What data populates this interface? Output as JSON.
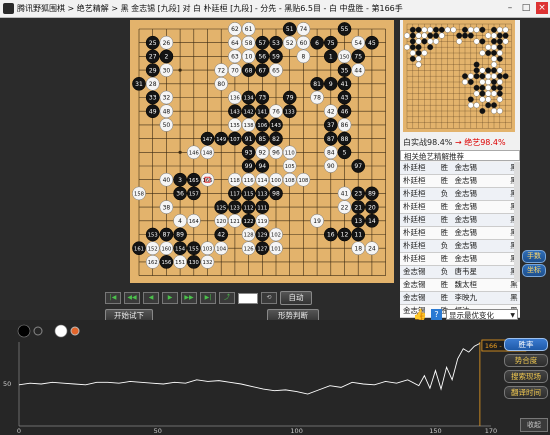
{
  "window": {
    "title": "腾讯野狐围棋 > 绝艺精解 > 黑 金志锡 [九段] 对 白 朴廷桓 [九段] - 分先 - 黑贴6.5目 - 白 中盘胜 - 第166手",
    "min": "–",
    "max": "□",
    "close": "×"
  },
  "board": {
    "size": 19,
    "stones": [
      [
        7,
        0,
        "w",
        "62"
      ],
      [
        8,
        0,
        "w",
        "61"
      ],
      [
        11,
        0,
        "b",
        "51"
      ],
      [
        12,
        0,
        "w",
        "74"
      ],
      [
        15,
        0,
        "b",
        "55"
      ],
      [
        1,
        1,
        "b",
        "25"
      ],
      [
        2,
        1,
        "w",
        "26"
      ],
      [
        7,
        1,
        "w",
        "64"
      ],
      [
        8,
        1,
        "w",
        "58"
      ],
      [
        9,
        1,
        "b",
        "57"
      ],
      [
        10,
        1,
        "b",
        "53"
      ],
      [
        11,
        1,
        "w",
        "52"
      ],
      [
        12,
        1,
        "w",
        "60"
      ],
      [
        13,
        1,
        "b",
        "6"
      ],
      [
        14,
        1,
        "b",
        "75"
      ],
      [
        16,
        1,
        "w",
        "54"
      ],
      [
        17,
        1,
        "b",
        "45"
      ],
      [
        1,
        2,
        "b",
        "27"
      ],
      [
        2,
        2,
        "b",
        "2"
      ],
      [
        7,
        2,
        "w",
        "63"
      ],
      [
        8,
        2,
        "w",
        "10"
      ],
      [
        9,
        2,
        "b",
        "56"
      ],
      [
        10,
        2,
        "b",
        "59"
      ],
      [
        12,
        2,
        "w",
        "8"
      ],
      [
        14,
        2,
        "b",
        "1"
      ],
      [
        15,
        2,
        "w",
        "150"
      ],
      [
        16,
        2,
        "b",
        "75"
      ],
      [
        1,
        3,
        "b",
        "29"
      ],
      [
        2,
        3,
        "w",
        "30"
      ],
      [
        6,
        3,
        "w",
        "72"
      ],
      [
        7,
        3,
        "w",
        "70"
      ],
      [
        8,
        3,
        "b",
        "68"
      ],
      [
        9,
        3,
        "b",
        "67"
      ],
      [
        10,
        3,
        "w",
        "65"
      ],
      [
        15,
        3,
        "b",
        "35"
      ],
      [
        16,
        3,
        "w",
        "44"
      ],
      [
        0,
        4,
        "b",
        "31"
      ],
      [
        1,
        4,
        "w",
        "28"
      ],
      [
        6,
        4,
        "w",
        "80"
      ],
      [
        13,
        4,
        "b",
        "81"
      ],
      [
        14,
        4,
        "b",
        "9"
      ],
      [
        15,
        4,
        "b",
        "41"
      ],
      [
        1,
        5,
        "b",
        "33"
      ],
      [
        2,
        5,
        "w",
        "32"
      ],
      [
        7,
        5,
        "w",
        "136"
      ],
      [
        8,
        5,
        "b",
        "134"
      ],
      [
        9,
        5,
        "b",
        "73"
      ],
      [
        11,
        5,
        "b",
        "79"
      ],
      [
        13,
        5,
        "w",
        "78"
      ],
      [
        15,
        5,
        "b",
        "43"
      ],
      [
        1,
        6,
        "b",
        "49"
      ],
      [
        2,
        6,
        "w",
        "48"
      ],
      [
        7,
        6,
        "b",
        "143"
      ],
      [
        8,
        6,
        "b",
        "142"
      ],
      [
        9,
        6,
        "b",
        "141"
      ],
      [
        10,
        6,
        "w",
        "76"
      ],
      [
        11,
        6,
        "b",
        "133"
      ],
      [
        14,
        6,
        "w",
        "42"
      ],
      [
        15,
        6,
        "b",
        "46"
      ],
      [
        2,
        7,
        "w",
        "50"
      ],
      [
        7,
        7,
        "w",
        "135"
      ],
      [
        8,
        7,
        "w",
        "138"
      ],
      [
        9,
        7,
        "b",
        "106"
      ],
      [
        10,
        7,
        "b",
        "143"
      ],
      [
        14,
        7,
        "b",
        "37"
      ],
      [
        15,
        7,
        "w",
        "86"
      ],
      [
        5,
        8,
        "b",
        "147"
      ],
      [
        6,
        8,
        "b",
        "149"
      ],
      [
        7,
        8,
        "b",
        "107"
      ],
      [
        8,
        8,
        "b",
        "91"
      ],
      [
        9,
        8,
        "b",
        "85"
      ],
      [
        10,
        8,
        "b",
        "82"
      ],
      [
        14,
        8,
        "b",
        "87"
      ],
      [
        15,
        8,
        "b",
        "88"
      ],
      [
        4,
        9,
        "w",
        "146"
      ],
      [
        5,
        9,
        "w",
        "148"
      ],
      [
        8,
        9,
        "b",
        "93"
      ],
      [
        9,
        9,
        "w",
        "92"
      ],
      [
        10,
        9,
        "w",
        "96"
      ],
      [
        11,
        9,
        "w",
        "110"
      ],
      [
        14,
        9,
        "w",
        "84"
      ],
      [
        15,
        9,
        "b",
        "5"
      ],
      [
        8,
        10,
        "b",
        "99"
      ],
      [
        9,
        10,
        "b",
        "94"
      ],
      [
        11,
        10,
        "w",
        "105"
      ],
      [
        14,
        10,
        "w",
        "90"
      ],
      [
        16,
        10,
        "b",
        "97"
      ],
      [
        2,
        11,
        "w",
        "40"
      ],
      [
        3,
        11,
        "b",
        "3"
      ],
      [
        4,
        11,
        "b",
        "165"
      ],
      [
        5,
        11,
        "w",
        "166"
      ],
      [
        7,
        11,
        "w",
        "118"
      ],
      [
        8,
        11,
        "w",
        "116"
      ],
      [
        9,
        11,
        "w",
        "114"
      ],
      [
        10,
        11,
        "w",
        "100"
      ],
      [
        11,
        11,
        "w",
        "108"
      ],
      [
        12,
        11,
        "w",
        "108"
      ],
      [
        0,
        12,
        "w",
        "158"
      ],
      [
        3,
        12,
        "b",
        "36"
      ],
      [
        4,
        12,
        "b",
        "157"
      ],
      [
        7,
        12,
        "b",
        "117"
      ],
      [
        8,
        12,
        "b",
        "115"
      ],
      [
        9,
        12,
        "b",
        "113"
      ],
      [
        10,
        12,
        "b",
        "98"
      ],
      [
        15,
        12,
        "w",
        "41"
      ],
      [
        16,
        12,
        "b",
        "23"
      ],
      [
        17,
        12,
        "b",
        "89"
      ],
      [
        2,
        13,
        "w",
        "38"
      ],
      [
        6,
        13,
        "b",
        "125"
      ],
      [
        7,
        13,
        "b",
        "123"
      ],
      [
        8,
        13,
        "b",
        "112"
      ],
      [
        9,
        13,
        "b",
        "111"
      ],
      [
        15,
        13,
        "w",
        "22"
      ],
      [
        16,
        13,
        "b",
        "21"
      ],
      [
        17,
        13,
        "b",
        "20"
      ],
      [
        3,
        14,
        "w",
        "4"
      ],
      [
        4,
        14,
        "w",
        "164"
      ],
      [
        6,
        14,
        "w",
        "120"
      ],
      [
        7,
        14,
        "w",
        "121"
      ],
      [
        8,
        14,
        "b",
        "122"
      ],
      [
        9,
        14,
        "w",
        "119"
      ],
      [
        13,
        14,
        "w",
        "19"
      ],
      [
        16,
        14,
        "b",
        "13"
      ],
      [
        17,
        14,
        "b",
        "14"
      ],
      [
        1,
        15,
        "b",
        "153"
      ],
      [
        2,
        15,
        "b",
        "87"
      ],
      [
        3,
        15,
        "b",
        "89"
      ],
      [
        6,
        15,
        "b",
        "42"
      ],
      [
        8,
        15,
        "w",
        "128"
      ],
      [
        9,
        15,
        "b",
        "129"
      ],
      [
        10,
        15,
        "w",
        "102"
      ],
      [
        14,
        15,
        "b",
        "16"
      ],
      [
        15,
        15,
        "b",
        "12"
      ],
      [
        16,
        15,
        "b",
        "11"
      ],
      [
        0,
        16,
        "b",
        "161"
      ],
      [
        1,
        16,
        "w",
        "152"
      ],
      [
        2,
        16,
        "w",
        "160"
      ],
      [
        3,
        16,
        "b",
        "154"
      ],
      [
        4,
        16,
        "b",
        "155"
      ],
      [
        5,
        16,
        "w",
        "103"
      ],
      [
        6,
        16,
        "w",
        "104"
      ],
      [
        8,
        16,
        "w",
        "126"
      ],
      [
        9,
        16,
        "b",
        "127"
      ],
      [
        10,
        16,
        "w",
        "101"
      ],
      [
        16,
        16,
        "w",
        "18"
      ],
      [
        17,
        16,
        "w",
        "24"
      ],
      [
        1,
        17,
        "w",
        "162"
      ],
      [
        2,
        17,
        "b",
        "156"
      ],
      [
        3,
        17,
        "w",
        "151"
      ],
      [
        4,
        17,
        "b",
        "130"
      ],
      [
        5,
        17,
        "w",
        "132"
      ]
    ],
    "last_move": [
      5,
      11
    ]
  },
  "minimap": {
    "stones": [
      [
        1,
        1,
        "b"
      ],
      [
        2,
        1,
        "b"
      ],
      [
        3,
        1,
        "w"
      ],
      [
        4,
        1,
        "w"
      ],
      [
        5,
        1,
        "b"
      ],
      [
        6,
        1,
        "b"
      ],
      [
        7,
        1,
        "w"
      ],
      [
        8,
        1,
        "w"
      ],
      [
        10,
        1,
        "b"
      ],
      [
        11,
        1,
        "w"
      ],
      [
        12,
        1,
        "w"
      ],
      [
        13,
        1,
        "b"
      ],
      [
        15,
        1,
        "b"
      ],
      [
        16,
        1,
        "w"
      ],
      [
        17,
        1,
        "w"
      ],
      [
        0,
        2,
        "w"
      ],
      [
        1,
        2,
        "b"
      ],
      [
        2,
        2,
        "w"
      ],
      [
        3,
        2,
        "w"
      ],
      [
        4,
        2,
        "b"
      ],
      [
        5,
        2,
        "b"
      ],
      [
        6,
        2,
        "w"
      ],
      [
        9,
        2,
        "b"
      ],
      [
        10,
        2,
        "b"
      ],
      [
        11,
        2,
        "b"
      ],
      [
        14,
        2,
        "w"
      ],
      [
        15,
        2,
        "w"
      ],
      [
        16,
        2,
        "b"
      ],
      [
        17,
        2,
        "b"
      ],
      [
        1,
        3,
        "b"
      ],
      [
        2,
        3,
        "w"
      ],
      [
        3,
        3,
        "b"
      ],
      [
        4,
        3,
        "w"
      ],
      [
        5,
        3,
        "w"
      ],
      [
        9,
        3,
        "w"
      ],
      [
        12,
        3,
        "w"
      ],
      [
        13,
        3,
        "b"
      ],
      [
        15,
        3,
        "b"
      ],
      [
        16,
        3,
        "b"
      ],
      [
        17,
        3,
        "w"
      ],
      [
        0,
        4,
        "w"
      ],
      [
        1,
        4,
        "b"
      ],
      [
        2,
        4,
        "b"
      ],
      [
        4,
        4,
        "b"
      ],
      [
        14,
        4,
        "w"
      ],
      [
        15,
        4,
        "w"
      ],
      [
        16,
        4,
        "b"
      ],
      [
        1,
        5,
        "w"
      ],
      [
        2,
        5,
        "b"
      ],
      [
        3,
        5,
        "w"
      ],
      [
        13,
        5,
        "w"
      ],
      [
        14,
        5,
        "b"
      ],
      [
        15,
        5,
        "b"
      ],
      [
        16,
        5,
        "w"
      ],
      [
        1,
        6,
        "b"
      ],
      [
        2,
        6,
        "w"
      ],
      [
        15,
        6,
        "w"
      ],
      [
        16,
        6,
        "b"
      ],
      [
        2,
        7,
        "w"
      ],
      [
        12,
        7,
        "b"
      ],
      [
        15,
        7,
        "w"
      ],
      [
        12,
        8,
        "b"
      ],
      [
        13,
        8,
        "w"
      ],
      [
        14,
        8,
        "b"
      ],
      [
        15,
        8,
        "b"
      ],
      [
        16,
        8,
        "w"
      ],
      [
        10,
        9,
        "b"
      ],
      [
        11,
        9,
        "w"
      ],
      [
        12,
        9,
        "b"
      ],
      [
        13,
        9,
        "b"
      ],
      [
        14,
        9,
        "w"
      ],
      [
        15,
        9,
        "w"
      ],
      [
        16,
        9,
        "b"
      ],
      [
        17,
        9,
        "b"
      ],
      [
        10,
        10,
        "w"
      ],
      [
        11,
        10,
        "b"
      ],
      [
        13,
        10,
        "w"
      ],
      [
        14,
        10,
        "w"
      ],
      [
        15,
        10,
        "b"
      ],
      [
        16,
        10,
        "w"
      ],
      [
        12,
        11,
        "b"
      ],
      [
        13,
        11,
        "b"
      ],
      [
        14,
        11,
        "w"
      ],
      [
        15,
        11,
        "b"
      ],
      [
        16,
        11,
        "b"
      ],
      [
        12,
        12,
        "w"
      ],
      [
        13,
        12,
        "b"
      ],
      [
        14,
        12,
        "w"
      ],
      [
        15,
        12,
        "w"
      ],
      [
        16,
        12,
        "b"
      ],
      [
        11,
        13,
        "b"
      ],
      [
        13,
        13,
        "w"
      ],
      [
        14,
        13,
        "w"
      ],
      [
        16,
        13,
        "w"
      ],
      [
        11,
        14,
        "w"
      ],
      [
        12,
        14,
        "w"
      ],
      [
        14,
        14,
        "b"
      ],
      [
        15,
        14,
        "b"
      ],
      [
        13,
        15,
        "b"
      ],
      [
        15,
        15,
        "w"
      ],
      [
        16,
        15,
        "w"
      ]
    ]
  },
  "score": {
    "label": "白实战98.4%",
    "ai": "→ 绝艺98.4%"
  },
  "related": {
    "header": "相关绝艺精解推荐",
    "rows": [
      [
        "朴廷桓",
        "胜",
        "金志锡",
        "黑"
      ],
      [
        "朴廷桓",
        "胜",
        "金志锡",
        "黑"
      ],
      [
        "朴廷桓",
        "负",
        "金志锡",
        "黑"
      ],
      [
        "朴廷桓",
        "胜",
        "金志锡",
        "黑"
      ],
      [
        "朴廷桓",
        "胜",
        "金志锡",
        "黑"
      ],
      [
        "朴廷桓",
        "胜",
        "金志锡",
        "黑"
      ],
      [
        "朴廷桓",
        "负",
        "金志锡",
        "黑"
      ],
      [
        "朴廷桓",
        "胜",
        "金志锡",
        "黑"
      ],
      [
        "金志锡",
        "负",
        "唐韦星",
        "黑"
      ],
      [
        "金志锡",
        "胜",
        "魏太桓",
        "黑"
      ],
      [
        "金志锡",
        "胜",
        "李映九",
        "黑"
      ],
      [
        "金志锡",
        "胜",
        "柯洁",
        "黑"
      ]
    ]
  },
  "side_buttons": {
    "a": "手数",
    "b": "坐标"
  },
  "nav": {
    "buttons": [
      "|◀",
      "◀◀",
      "◀",
      "▶",
      "▶▶",
      "▶|",
      "⤴"
    ],
    "page_btn": "⟲",
    "auto": "自动"
  },
  "actions": {
    "try": "开始试下",
    "judge": "形势判断",
    "select": "显示最优变化"
  },
  "graph": {
    "tooltip": "166 - 98.4%",
    "y_label": "50",
    "x_ticks": [
      0,
      50,
      100,
      150,
      170
    ]
  },
  "chart_data": {
    "type": "line",
    "title": "",
    "xlabel": "",
    "ylabel": "",
    "xlim": [
      0,
      170
    ],
    "ylim": [
      0,
      100
    ],
    "x": [
      0,
      4,
      8,
      12,
      16,
      20,
      24,
      28,
      32,
      36,
      40,
      44,
      48,
      52,
      56,
      60,
      64,
      68,
      72,
      76,
      80,
      84,
      88,
      92,
      96,
      100,
      104,
      108,
      112,
      116,
      120,
      124,
      128,
      132,
      136,
      140,
      144,
      146,
      148,
      150,
      152,
      154,
      156,
      158,
      160,
      162,
      164,
      166
    ],
    "series": [
      {
        "name": "",
        "values": [
          49,
          51,
          50,
          52,
          51,
          50,
          49,
          52,
          52,
          51,
          53,
          52,
          51,
          50,
          52,
          51,
          55,
          53,
          54,
          52,
          50,
          47,
          44,
          42,
          43,
          41,
          38,
          43,
          48,
          46,
          52,
          50,
          49,
          53,
          51,
          55,
          48,
          60,
          45,
          66,
          44,
          70,
          55,
          80,
          92,
          88,
          95,
          98.4
        ]
      }
    ]
  },
  "right_buttons": {
    "rate": "胜率",
    "dur": "势合度",
    "search": "搜索现场",
    "time": "翻译时间"
  },
  "collapse": "收起"
}
